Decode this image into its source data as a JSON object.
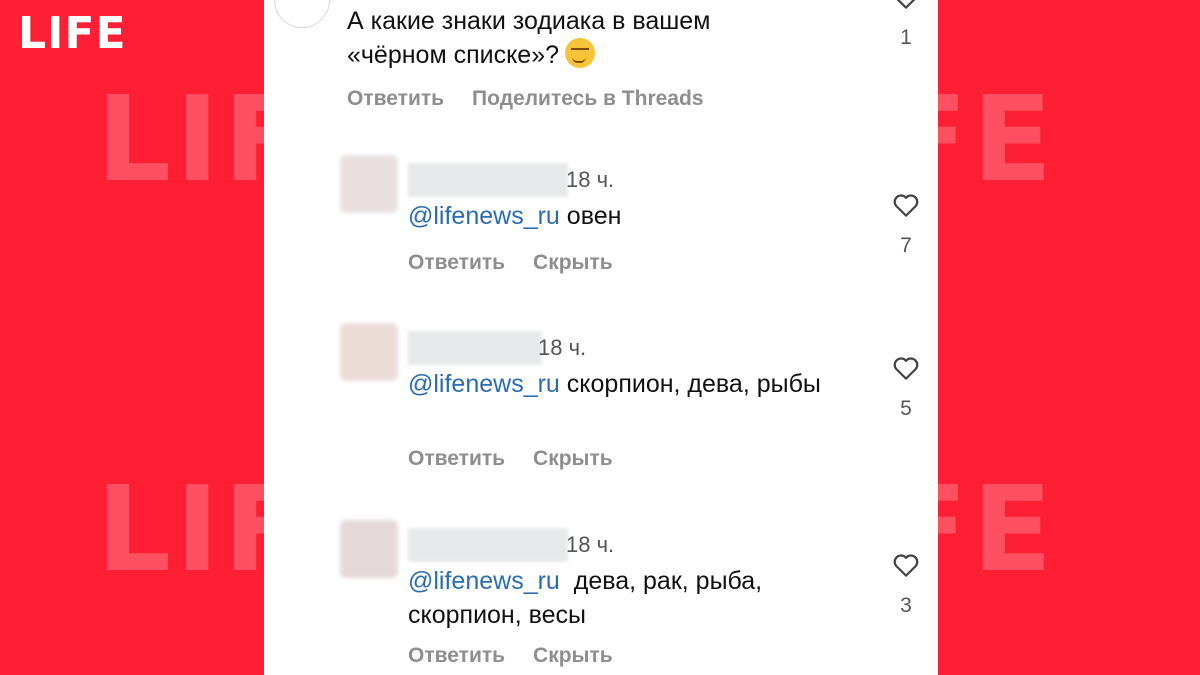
{
  "brand": {
    "logo": "LIFE",
    "watermark": "LIFE"
  },
  "post": {
    "text_line1": "А какие знаки зодиака в вашем",
    "text_line2": "«чёрном списке»?",
    "reply_label": "Ответить",
    "share_label": "Поделитесь в Threads",
    "like_count": "1"
  },
  "comments": [
    {
      "time": "18 ч.",
      "mention": "@lifenews_ru",
      "text": " овен",
      "reply_label": "Ответить",
      "hide_label": "Скрыть",
      "like_count": "7"
    },
    {
      "time": "18 ч.",
      "mention": "@lifenews_ru",
      "text": " скорпион, дева, рыбы",
      "reply_label": "Ответить",
      "hide_label": "Скрыть",
      "like_count": "5"
    },
    {
      "time": "18 ч.",
      "mention": "@lifenews_ru",
      "text": "  дева, рак, рыба, скорпион, весы",
      "reply_label": "Ответить",
      "hide_label": "Скрыть",
      "like_count": "3"
    }
  ],
  "icons": {
    "like": "heart-outline-icon",
    "emoji": "smirking-face-emoji"
  },
  "colors": {
    "background": "#fe1f35",
    "mention": "#2b6cb0",
    "muted": "#8e8e8e"
  }
}
